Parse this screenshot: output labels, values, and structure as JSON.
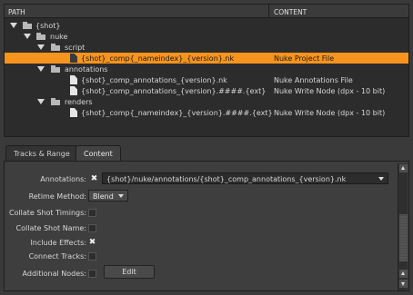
{
  "tree": {
    "headers": {
      "path": "PATH",
      "content": "CONTENT"
    },
    "rows": [
      {
        "label": "{shot}",
        "content": ""
      },
      {
        "label": "nuke",
        "content": ""
      },
      {
        "label": "script",
        "content": ""
      },
      {
        "label": "{shot}_comp{_nameindex}_{version}.nk",
        "content": "Nuke Project File"
      },
      {
        "label": "annotations",
        "content": ""
      },
      {
        "label": "{shot}_comp_annotations_{version}.nk",
        "content": "Nuke Annotations File"
      },
      {
        "label": "{shot}_comp_annotations_{version}.####.{ext}",
        "content": "Nuke Write Node (dpx - 10 bit)"
      },
      {
        "label": "renders",
        "content": ""
      },
      {
        "label": "{shot}_comp{_nameindex}_{version}.####.{ext}",
        "content": "Nuke Write Node (dpx - 10 bit)"
      }
    ]
  },
  "tabs": [
    {
      "label": "Tracks & Range"
    },
    {
      "label": "Content"
    }
  ],
  "form": {
    "annotations_label": "Annotations:",
    "annotations_value": "{shot}/nuke/annotations/{shot}_comp_annotations_{version}.nk",
    "retime_label": "Retime Method:",
    "retime_value": "Blend",
    "collate_timings_label": "Collate Shot Timings:",
    "collate_name_label": "Collate Shot Name:",
    "include_effects_label": "Include Effects:",
    "connect_tracks_label": "Connect Tracks:",
    "additional_nodes_label": "Additional Nodes:",
    "edit_button": "Edit"
  },
  "colors": {
    "selection": "#f7941d"
  }
}
